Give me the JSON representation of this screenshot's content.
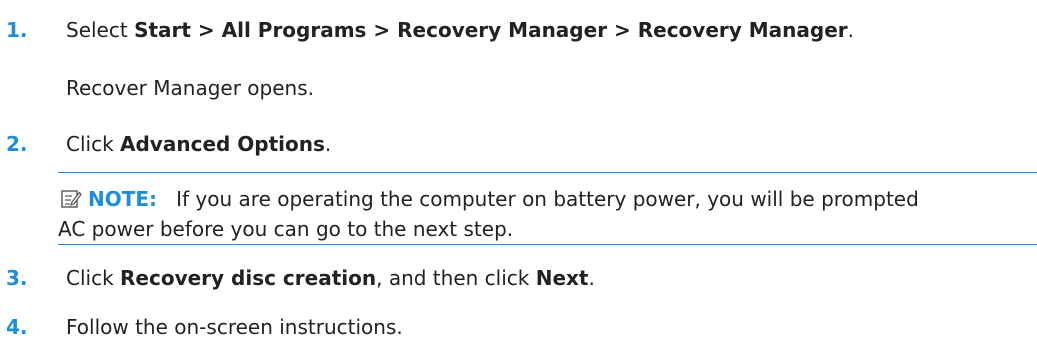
{
  "steps": [
    {
      "number": "1.",
      "prefix": "Select ",
      "bold": "Start > All Programs > Recovery Manager > Recovery Manager",
      "suffix": "."
    },
    {
      "number": "2.",
      "prefix": "Click ",
      "bold": "Advanced Options",
      "suffix": "."
    },
    {
      "number": "3.",
      "prefix": "Click ",
      "bold": "Recovery disc creation",
      "middle": ", and then click ",
      "bold2": "Next",
      "suffix": "."
    },
    {
      "number": "4.",
      "text": "Follow the on-screen instructions."
    }
  ],
  "step1_result": "Recover Manager opens.",
  "note": {
    "icon": "note-pencil-icon",
    "label": "NOTE:",
    "line1": "If you are operating the computer on battery power, you will be prompted",
    "line2": "AC power before you can go to the next step."
  },
  "colors": {
    "accent": "#1a8fe0",
    "text": "#222222"
  }
}
